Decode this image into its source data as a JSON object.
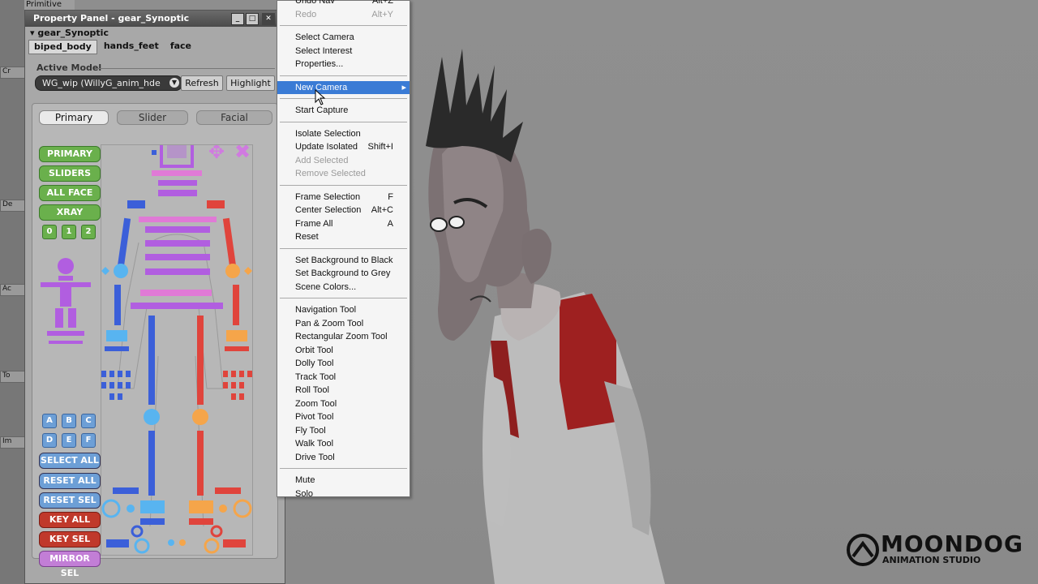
{
  "app": {
    "top_label": "Primitive",
    "side_labels": [
      "Cr",
      "De",
      "Ac",
      "To",
      "Im"
    ]
  },
  "panel": {
    "title": "Property Panel - gear_Synoptic",
    "synoptic_header": "gear_Synoptic",
    "tabs": [
      "biped_body",
      "hands_feet",
      "face"
    ],
    "active_model_label": "Active Model",
    "model_value": "WG_wip (WillyG_anim_hde",
    "refresh_label": "Refresh",
    "highlight_label": "Highlight",
    "synoptic_tabs": [
      "Primary",
      "Slider",
      "Facial"
    ],
    "buttons_top": [
      "PRIMARY",
      "SLIDERS",
      "ALL FACE",
      "XRAY"
    ],
    "xray_levels": [
      "0",
      "1",
      "2"
    ],
    "letter_buttons": [
      "A",
      "B",
      "C",
      "D",
      "E",
      "F"
    ],
    "buttons_bottom": [
      "SELECT ALL",
      "RESET ALL",
      "RESET SEL",
      "KEY ALL",
      "KEY SEL",
      "MIRROR SEL"
    ]
  },
  "menu": {
    "items": [
      {
        "label": "Undo Nav",
        "shortcut": "Alt+Z",
        "disabled": false
      },
      {
        "label": "Redo",
        "shortcut": "Alt+Y",
        "disabled": true
      },
      {
        "sep": true
      },
      {
        "label": "Select Camera",
        "shortcut": "",
        "disabled": false
      },
      {
        "label": "Select Interest",
        "shortcut": "",
        "disabled": false
      },
      {
        "label": "Properties...",
        "shortcut": "",
        "disabled": false
      },
      {
        "sep": true
      },
      {
        "label": "New Camera",
        "shortcut": "",
        "disabled": false,
        "selected": true,
        "submenu": true
      },
      {
        "sep": true
      },
      {
        "label": "Start Capture",
        "shortcut": "",
        "disabled": false
      },
      {
        "sep": true
      },
      {
        "label": "Isolate Selection",
        "shortcut": "",
        "disabled": false
      },
      {
        "label": "Update Isolated",
        "shortcut": "Shift+I",
        "disabled": false
      },
      {
        "label": "Add Selected",
        "shortcut": "",
        "disabled": true
      },
      {
        "label": "Remove Selected",
        "shortcut": "",
        "disabled": true
      },
      {
        "sep": true
      },
      {
        "label": "Frame Selection",
        "shortcut": "F",
        "disabled": false
      },
      {
        "label": "Center Selection",
        "shortcut": "Alt+C",
        "disabled": false
      },
      {
        "label": "Frame All",
        "shortcut": "A",
        "disabled": false
      },
      {
        "label": "Reset",
        "shortcut": "",
        "disabled": false
      },
      {
        "sep": true
      },
      {
        "label": "Set Background to Black",
        "shortcut": "",
        "disabled": false
      },
      {
        "label": "Set Background to Grey",
        "shortcut": "",
        "disabled": false
      },
      {
        "label": "Scene Colors...",
        "shortcut": "",
        "disabled": false
      },
      {
        "sep": true
      },
      {
        "label": "Navigation Tool",
        "shortcut": "",
        "disabled": false
      },
      {
        "label": "Pan & Zoom Tool",
        "shortcut": "",
        "disabled": false
      },
      {
        "label": "Rectangular Zoom Tool",
        "shortcut": "",
        "disabled": false
      },
      {
        "label": "Orbit Tool",
        "shortcut": "",
        "disabled": false
      },
      {
        "label": "Dolly Tool",
        "shortcut": "",
        "disabled": false
      },
      {
        "label": "Track Tool",
        "shortcut": "",
        "disabled": false
      },
      {
        "label": "Roll Tool",
        "shortcut": "",
        "disabled": false
      },
      {
        "label": "Zoom Tool",
        "shortcut": "",
        "disabled": false
      },
      {
        "label": "Pivot Tool",
        "shortcut": "",
        "disabled": false
      },
      {
        "label": "Fly Tool",
        "shortcut": "",
        "disabled": false
      },
      {
        "label": "Walk Tool",
        "shortcut": "",
        "disabled": false
      },
      {
        "label": "Drive Tool",
        "shortcut": "",
        "disabled": false
      },
      {
        "sep": true
      },
      {
        "label": "Mute",
        "shortcut": "",
        "disabled": false
      },
      {
        "label": "Solo",
        "shortcut": "",
        "disabled": false
      }
    ]
  },
  "logo": {
    "name": "MOONDOG",
    "tagline": "ANIMATION STUDIO"
  },
  "colors": {
    "menu_highlight": "#3a7bd5",
    "left_limb": "#3b5fd9",
    "right_limb": "#e0443c",
    "spine": "#b15ee0",
    "head_pink": "#e07ad6",
    "left_orange": "#f5a54a",
    "light_blue": "#58b4f0"
  }
}
